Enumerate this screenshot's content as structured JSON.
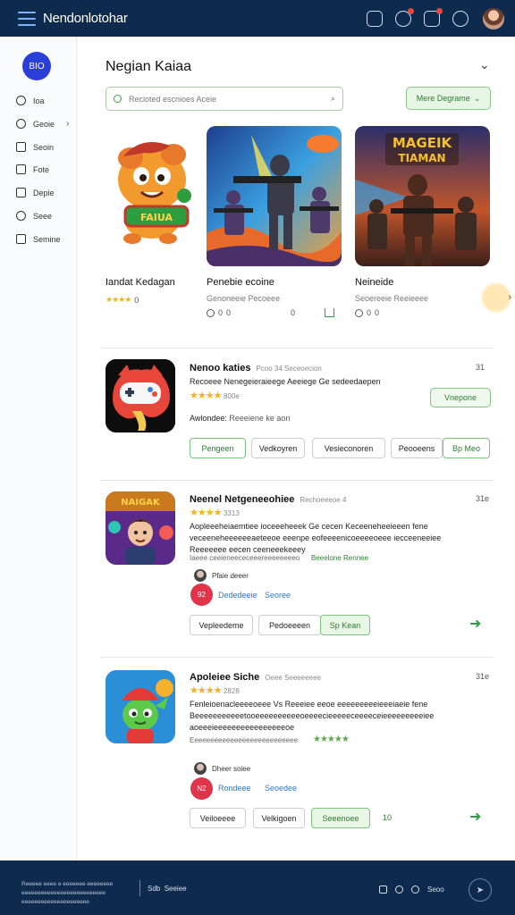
{
  "header": {
    "title": "Nendonlotohar",
    "icons": [
      "grid-icon",
      "bell-icon",
      "notification-icon",
      "refresh-icon"
    ],
    "badge_color": "#e34a3c",
    "bar_color": "#0e2a4c"
  },
  "sidebar": {
    "logo": "BIO",
    "items": [
      {
        "label": "Ioa",
        "icon": "circle-icon"
      },
      {
        "label": "Geoie",
        "icon": "search-icon"
      },
      {
        "label": "Seoin",
        "icon": "square-icon"
      },
      {
        "label": "Fote",
        "icon": "grid-icon"
      },
      {
        "label": "Depie",
        "icon": "list-icon"
      },
      {
        "label": "Seee",
        "icon": "smile-icon"
      },
      {
        "label": "Semine",
        "icon": "image-icon"
      }
    ]
  },
  "main": {
    "title": "Negian Kaiaa",
    "search_placeholder": "Recioted escnioes Aceie",
    "more_button": "Mere Degrame",
    "accent_color": "#2e7d32"
  },
  "featured": [
    {
      "title": "Iandat Kedagan",
      "rating": "★★★★",
      "rating_value": "0"
    },
    {
      "title": "Penebie ecoine",
      "subtitle": "Genoneeie Pecoeee",
      "stat1": "0",
      "stat2": "0",
      "stat3": "0"
    },
    {
      "title": "Neineide",
      "subtitle": "Seoereeie Reeieeee",
      "stat1": "0",
      "stat2": "0"
    }
  ],
  "list": [
    {
      "title": "Nenoo katies",
      "meta": "Pcoo 34 Seceoecion",
      "num": "31",
      "rating": "★★★★",
      "rating_text": "800e",
      "desc": "Recoeee Nenegeieraieege Aeeiege Ge sedeedaepen",
      "tag_label": "Awlondee",
      "tag_text": "Reeeiene ke aon",
      "install": "Vnepone",
      "buttons": [
        "Pengeen",
        "Vedkoyren",
        "Vesieconoren",
        "Peooeens",
        "Bp Meo"
      ]
    },
    {
      "title": "Neenel Netgeneeohiee",
      "meta": "Rechoeeeoe 4",
      "num": "31e",
      "rating": "★★★★",
      "rating_text": "3313",
      "desc1": "Aopleeeheiaemtiee ioceeeheeek Ge cecen Keceeneheeieeen fene",
      "desc2": "veceeneheeeeeeaeteeoe eeenpe eofeeeenicoeeeeoeee iecceeneeiee",
      "desc3": "Reeeeeee eecen ceeneeekeeey",
      "small": "Iaeee ceeieneececeeereeeeeeeeo",
      "small_tag": "Beeelone Rennee",
      "user": "Pfaie deeer",
      "red_label": "92",
      "link1": "Dededeeie",
      "link2": "Seoree",
      "buttons": [
        "Vepleedeme",
        "Pedoeeeen",
        "Sp Kean"
      ]
    },
    {
      "title": "Apoleiee Siche",
      "meta": "Oeee Seeeeeeee",
      "num": "31e",
      "rating": "★★★★",
      "rating_text": "2828",
      "desc1": "Fenleioenacleeeeoeee Vs Reeeiee eeoe eeeeeeeeeieeeiaeie fene",
      "desc2": "Beeeeeeeeeeetooeeeeeeeeeeoeeeecieeeeeceeeeceieeeeeeeeeiee",
      "desc3": "aoeeeieeeeeeeeeeeeeeeeoe",
      "small": "Eeeeeeeeeeeeeeeeeeeeeeeeeee",
      "small_rating": "★★★★★",
      "user": "Dheer soiee",
      "red_label": "N2",
      "link1": "Rondeee",
      "link2": "Seoedee",
      "buttons": [
        "Veiloeeee",
        "Velkigoen",
        "Seeenoee"
      ],
      "count": "10"
    }
  ],
  "footer": {
    "text": "Reeeee eeee e eeeeeee eeeeeeee eeeeeeeeeeeeeeeeeeeeeeeeee eeeeeeeeeeeeeeeeeeeee",
    "mid_a": "Sdb",
    "mid_b": "Seeiee",
    "right_label": "Seoo"
  }
}
